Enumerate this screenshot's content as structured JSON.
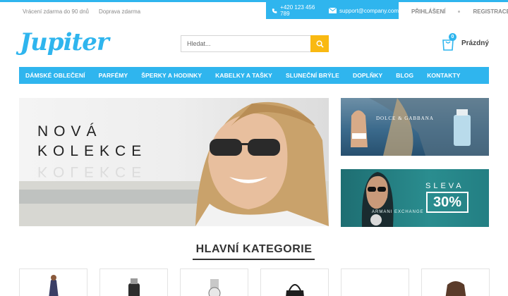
{
  "topbar": {
    "left_links": [
      "Vrácení zdarma do 90 dnů",
      "Doprava zdarma"
    ],
    "phone": "+420 123 456 789",
    "email": "support@company.com",
    "login": "PŘIHLÁŠENÍ",
    "register": "REGISTRACE"
  },
  "header": {
    "logo": "Jupiter",
    "search_placeholder": "Hledat...",
    "cart_count": "0",
    "cart_label": "Prázdný"
  },
  "nav": {
    "items": [
      "DÁMSKÉ OBLEČENÍ",
      "PARFÉMY",
      "ŠPERKY A HODINKY",
      "KABELKY A TAŠKY",
      "SLUNEČNÍ BRÝLE",
      "DOPLŇKY",
      "BLOG",
      "KONTAKTY"
    ]
  },
  "hero": {
    "title_line1": "NOVÁ",
    "title_line2": "KOLEKCE"
  },
  "banners": {
    "banner1_brand": "DOLCE & GABBANA",
    "banner2_sale_word": "SLEVA",
    "banner2_sale_value": "30%",
    "banner2_brand": "ARMANI EXCHANGE"
  },
  "categories": {
    "title": "HLAVNÍ KATEGORIE"
  },
  "colors": {
    "accent": "#2fb5ee",
    "search_button": "#f9b912"
  }
}
